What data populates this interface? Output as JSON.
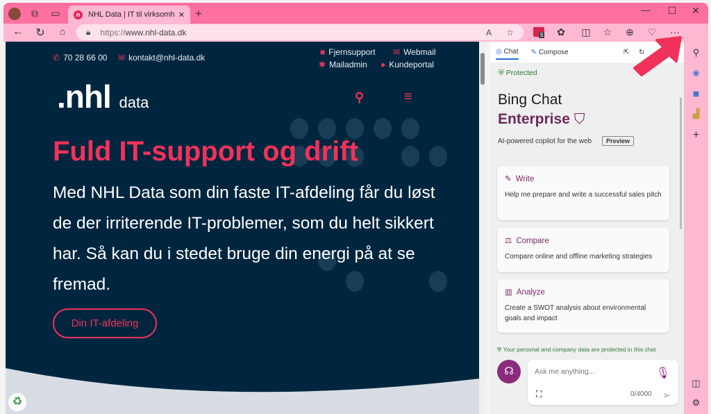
{
  "browser": {
    "tab_title": "NHL Data | IT til virksomheder | F",
    "url_scheme": "https://",
    "url_host": "www.nhl-data.dk",
    "extension_badge": "5"
  },
  "site": {
    "phone": "70 28 66 00",
    "email": "kontakt@nhl-data.dk",
    "links": [
      "Fjernsupport",
      "Webmail",
      "Mailadmin",
      "Kundeportal"
    ],
    "logo": ".nhl",
    "logo_suffix": "data",
    "headline": "Fuld IT-support og drift",
    "body": "Med NHL Data som din faste IT-afdeling får du løst de der irriterende IT-problemer, som du helt sikkert har. Så kan du i stedet bruge din energi på at se fremad.",
    "cta": "Din IT-afdeling",
    "accent": "#f0325a",
    "background": "#00263f"
  },
  "chat": {
    "tabs": [
      "Chat",
      "Compose"
    ],
    "protected": "Protected",
    "title1": "Bing Chat",
    "title2": "Enterprise",
    "subtitle": "AI-powered copilot for the web",
    "preview": "Preview",
    "cards": [
      {
        "title": "Write",
        "text": "Help me prepare and write a successful sales pitch"
      },
      {
        "title": "Compare",
        "text": "Compare online and offline marketing strategies"
      },
      {
        "title": "Analyze",
        "text": "Create a SWOT analysis about environmental goals and impact"
      }
    ],
    "privacy": "Your personal and company data are protected in this chat",
    "placeholder": "Ask me anything...",
    "counter": "0/4000"
  }
}
